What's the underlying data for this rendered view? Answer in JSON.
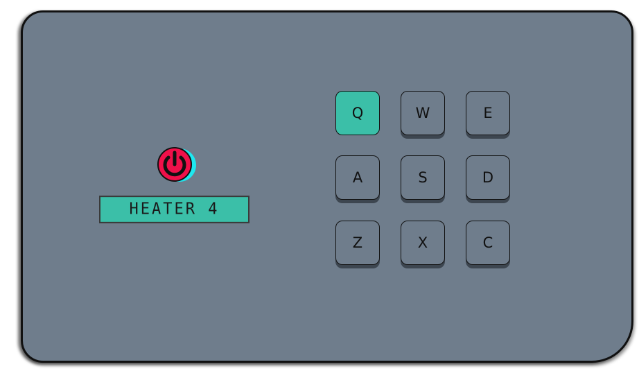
{
  "panel": {
    "bg_color": "#6f7d8c",
    "border_color": "#111111"
  },
  "power": {
    "icon": "power-icon",
    "on_color": "#f0104a",
    "glow_color": "#1ee8f0"
  },
  "display": {
    "text": "HEATER 4",
    "bg_color": "#3bbfa8"
  },
  "drum_pad": {
    "active_color": "#3bbfa8",
    "keys": [
      {
        "label": "Q",
        "active": true
      },
      {
        "label": "W",
        "active": false
      },
      {
        "label": "E",
        "active": false
      },
      {
        "label": "A",
        "active": false
      },
      {
        "label": "S",
        "active": false
      },
      {
        "label": "D",
        "active": false
      },
      {
        "label": "Z",
        "active": false
      },
      {
        "label": "X",
        "active": false
      },
      {
        "label": "C",
        "active": false
      }
    ]
  }
}
